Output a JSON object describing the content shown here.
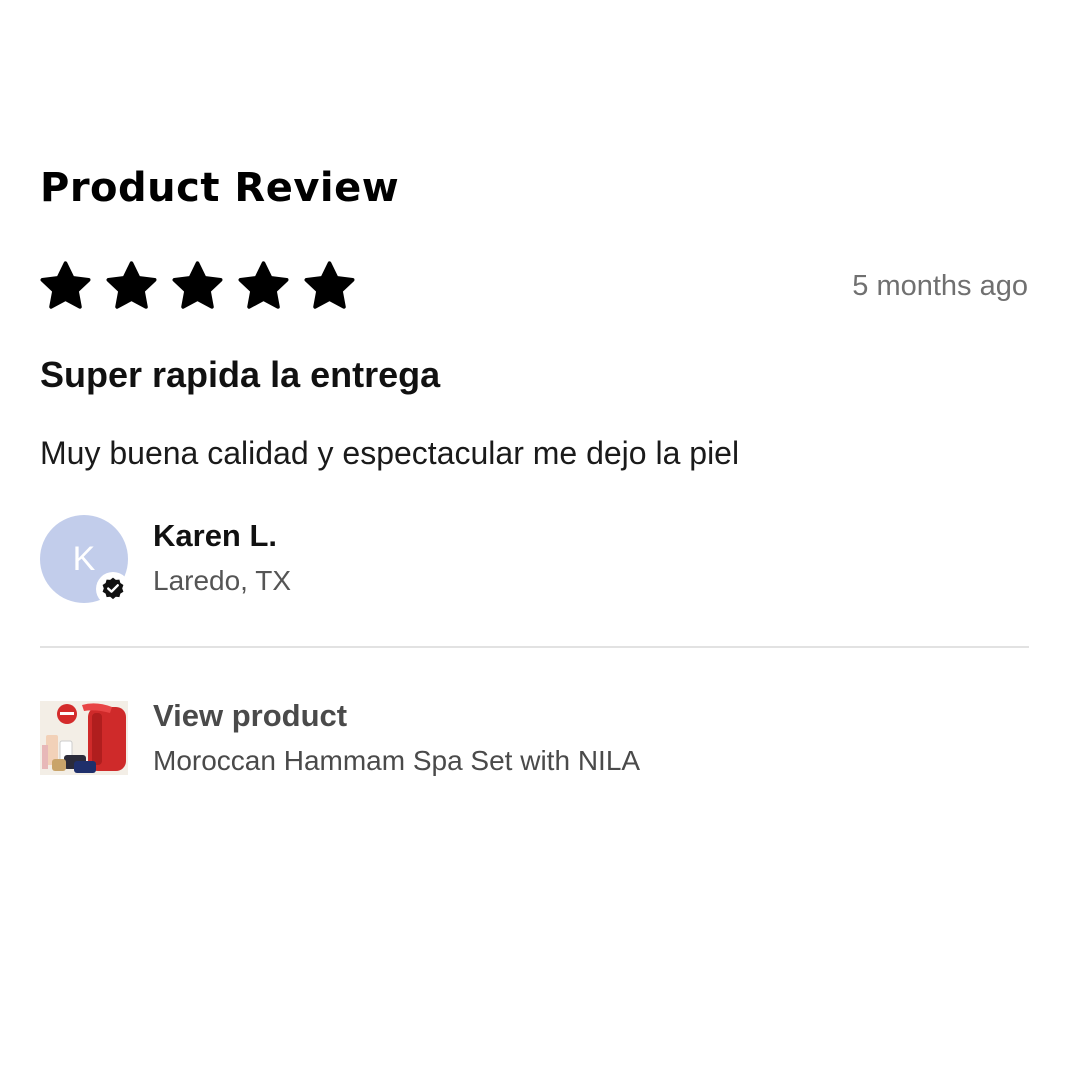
{
  "header": {
    "title": "Product Review"
  },
  "review": {
    "rating": 5,
    "rating_max": 5,
    "time_ago": "5 months ago",
    "title": "Super rapida la entrega",
    "body": "Muy buena calidad y espectacular me dejo la piel"
  },
  "author": {
    "initial": "K",
    "name": "Karen L.",
    "location": "Laredo, TX",
    "avatar_color": "#c2cdeb",
    "verified": true
  },
  "product": {
    "link_label": "View product",
    "name": "Moroccan Hammam Spa Set with NILA"
  },
  "icons": {
    "star": "star-icon",
    "verified": "verified-check-icon"
  }
}
